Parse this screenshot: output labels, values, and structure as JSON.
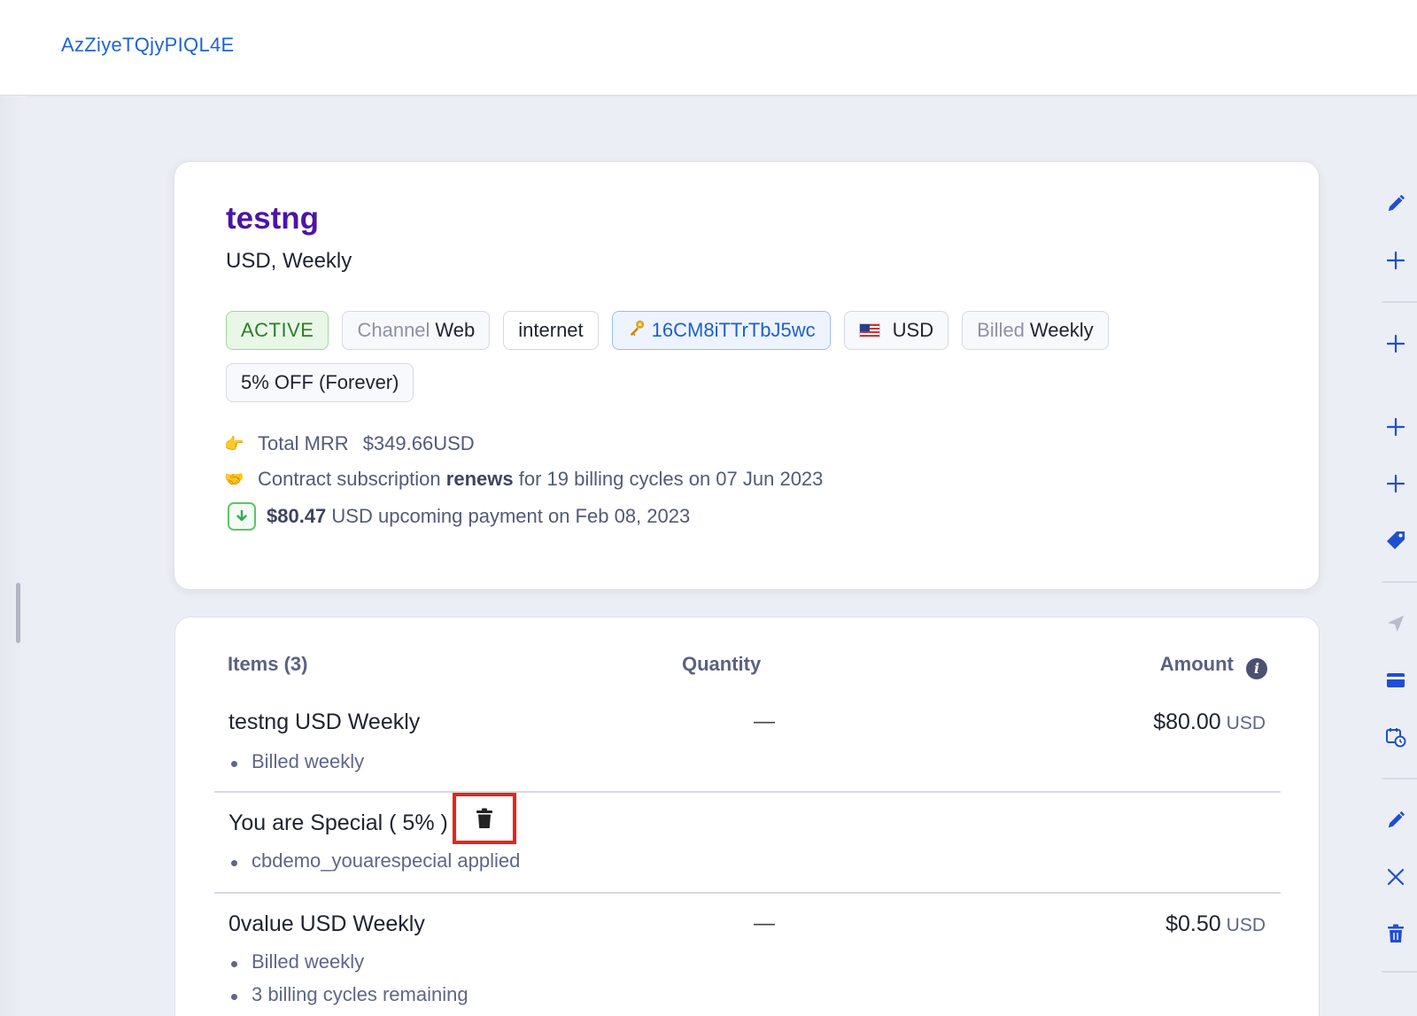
{
  "topbar": {
    "link": "AzZiyeTQjyPIQL4E"
  },
  "summary": {
    "plan_name": "testng",
    "plan_sub": "USD, Weekly",
    "tags": {
      "status": "ACTIVE",
      "channel_label": "Channel",
      "channel_value": "Web",
      "internet": "internet",
      "id": "16CM8iTTrTbJ5wc",
      "currency": "USD",
      "billed_label": "Billed",
      "billed_value": "Weekly",
      "discount": "5% OFF (Forever)"
    },
    "mrr_label": "Total MRR",
    "mrr_value": "$349.66USD",
    "contract_prefix": "Contract subscription",
    "contract_bold": "renews",
    "contract_suffix": "for 19 billing cycles on 07 Jun 2023",
    "payment_amount": "$80.47",
    "payment_suffix": "USD upcoming payment on Feb 08, 2023"
  },
  "items": {
    "header_items": "Items (3)",
    "header_qty": "Quantity",
    "header_amount": "Amount",
    "rows": [
      {
        "name": "testng USD Weekly",
        "qty": "—",
        "amount": "$80.00",
        "currency": "USD",
        "bullets": [
          "Billed weekly"
        ]
      },
      {
        "name": "You are Special ( 5% )",
        "bullets": [
          "cbdemo_youarespecial applied"
        ]
      },
      {
        "name": "0value USD Weekly",
        "qty": "—",
        "amount": "$0.50",
        "currency": "USD",
        "bullets": [
          "Billed weekly",
          "3 billing cycles remaining"
        ]
      }
    ]
  },
  "icons": {
    "side": [
      "pencil-icon",
      "plus-icon",
      "plus-icon",
      "plus-icon",
      "plus-icon",
      "tag-icon",
      "send-icon",
      "card-icon",
      "calendar-clock-icon",
      "pencil-icon",
      "close-icon",
      "trash-icon"
    ],
    "accent": "#1f4fd1",
    "disabled": "#b8bccb",
    "highlight": "#e8241a"
  }
}
